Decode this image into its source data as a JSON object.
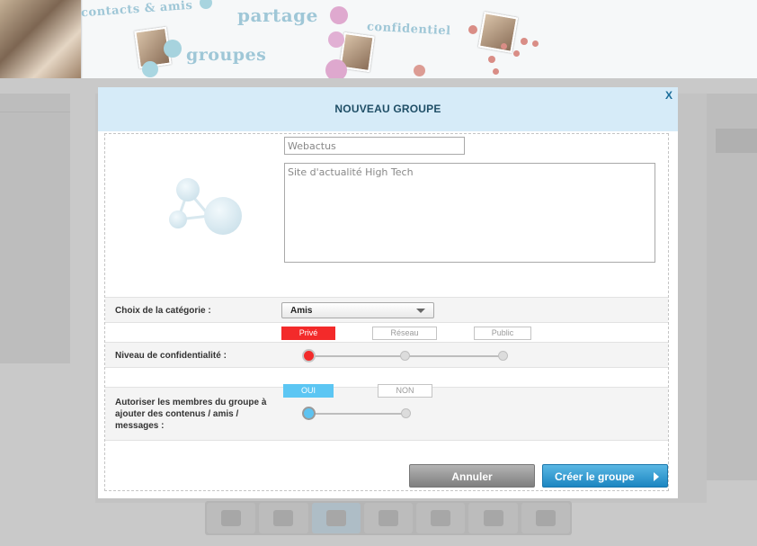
{
  "banner": {
    "words": [
      "contacts & amis",
      "partage",
      "groupes",
      "confidentiel"
    ]
  },
  "modal": {
    "title": "NOUVEAU GROUPE",
    "close_label": "X",
    "name_value": "Webactus",
    "description_value": "Site d'actualité High Tech",
    "category": {
      "label": "Choix de la catégorie :",
      "selected": "Amis"
    },
    "privacy": {
      "label": "Niveau de confidentialité :",
      "options": [
        "Privé",
        "Réseau",
        "Public"
      ],
      "selected_index": 0
    },
    "members": {
      "label": "Autoriser les membres du groupe à ajouter des contenus / amis / messages :",
      "options": [
        "OUI",
        "NON"
      ],
      "selected_index": 0
    },
    "buttons": {
      "cancel": "Annuler",
      "create": "Créer le groupe"
    }
  },
  "colors": {
    "modal_header_bg": "#d6ebf8",
    "title_color": "#1f4e66",
    "privacy_active": "#f32a2a",
    "members_active": "#5cc6f3",
    "create_button": "#1c86c1",
    "cancel_button": "#7e7e7e"
  },
  "icons": {
    "logo": "network-bubbles-icon",
    "select_caret": "chevron-down-icon",
    "create_arrow": "arrow-right-icon"
  }
}
